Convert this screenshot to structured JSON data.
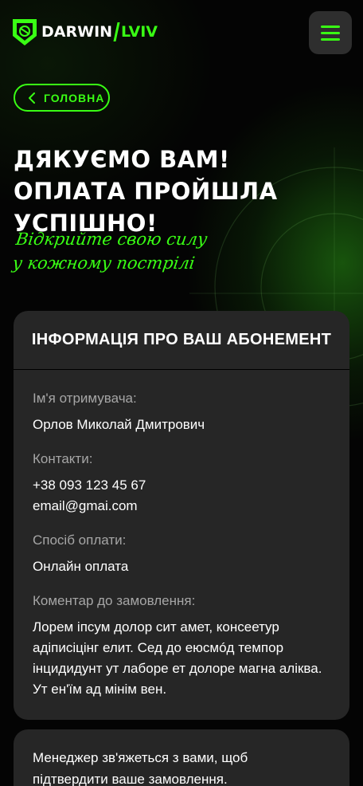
{
  "header": {
    "logo_word": "DARWIN",
    "logo_city": "LVIV",
    "menu_icon": "hamburger-icon"
  },
  "colors": {
    "accent": "#39ff14",
    "background": "#050505",
    "card": "#262626",
    "muted_text": "#a6a6a6"
  },
  "nav": {
    "back_label": "ГОЛОВНА",
    "back_icon": "chevron-left-icon"
  },
  "page": {
    "title": "ДЯКУЄМО ВАМ! ОПЛАТА ПРОЙШЛА УСПІШНО!",
    "slogan_line1": "Відкрийте свою силу",
    "slogan_line2": "у кожному пострілі"
  },
  "subscription": {
    "title": "ІНФОРМАЦІЯ ПРО ВАШ АБОНЕМЕНТ",
    "recipient_label": "Ім'я отримувача:",
    "recipient_value": "Орлов Миколай Дмитрович",
    "contacts_label": "Контакти:",
    "phone": "+38 093 123 45 67",
    "email": "email@gmai.com",
    "payment_label": "Спосіб оплати:",
    "payment_value": "Онлайн оплата",
    "comment_label": "Коментар до замовлення:",
    "comment_value": "Лорем іпсум долор сит амет, консеетур адіписіцінг елит. Сед до еюсмóд темпор інцидидунт ут лаборе ет долоре магна аліква. Ут ен'їм ад мінім вен."
  },
  "notice": {
    "text": "Менеджер зв'яжеться з вами, щоб підтвердити ваше замовлення."
  }
}
